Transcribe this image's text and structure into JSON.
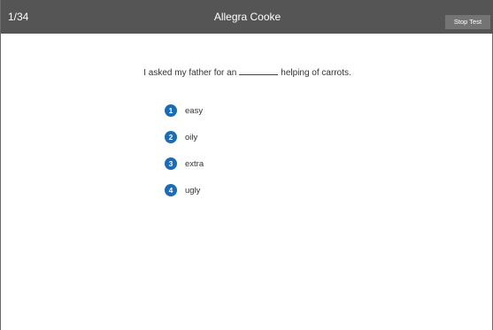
{
  "header": {
    "progress": "1/34",
    "candidate_name": "Allegra Cooke",
    "stop_label": "Stop Test"
  },
  "question": {
    "before_blank": "I asked my father for an",
    "after_blank": "helping of carrots."
  },
  "options": [
    {
      "number": "1",
      "label": "easy"
    },
    {
      "number": "2",
      "label": "oily"
    },
    {
      "number": "3",
      "label": "extra"
    },
    {
      "number": "4",
      "label": "ugly"
    }
  ],
  "colors": {
    "header_bg": "#555555",
    "button_bg": "#747474",
    "badge": "#1a6cb6"
  }
}
